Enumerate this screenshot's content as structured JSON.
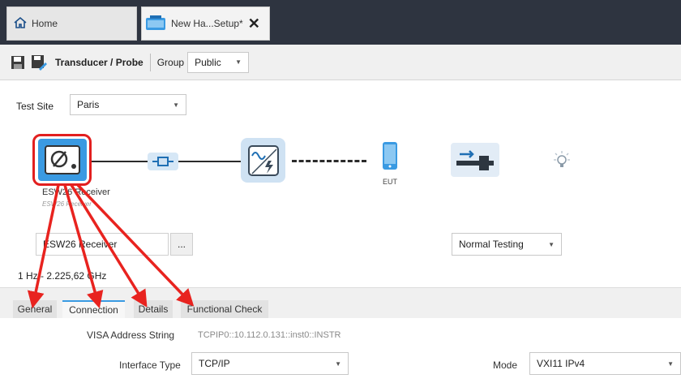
{
  "tabs": {
    "home_label": "Home",
    "setup_label": "New Ha...Setup*",
    "close_symbol": "✕"
  },
  "toolbar": {
    "title": "Transducer / Probe",
    "group_label": "Group",
    "group_value": "Public"
  },
  "test_site": {
    "label": "Test Site",
    "value": "Paris"
  },
  "chain": {
    "receiver_name": "ESW26 Receiver",
    "receiver_caption_visible": "ESW26 Receiver",
    "eut_label": "EUT"
  },
  "device": {
    "name_value": "ESW26 Receiver",
    "browse_label": "...",
    "frequency_range": "1 Hz - 2.225,62 GHz",
    "mode_value": "Normal Testing"
  },
  "subtabs": [
    {
      "label": "General"
    },
    {
      "label": "Connection"
    },
    {
      "label": "Details"
    },
    {
      "label": "Functional Check"
    }
  ],
  "connection": {
    "visa_label": "VISA Address String",
    "visa_value": "TCPIP0::10.112.0.131::inst0::INSTR",
    "interface_label": "Interface Type",
    "interface_value": "TCP/IP",
    "mode_label": "Mode",
    "mode_value": "VXI11 IPv4"
  },
  "colors": {
    "accent": "#3a9ae2",
    "highlight": "#e21f1f",
    "header_bg": "#2e3440"
  }
}
